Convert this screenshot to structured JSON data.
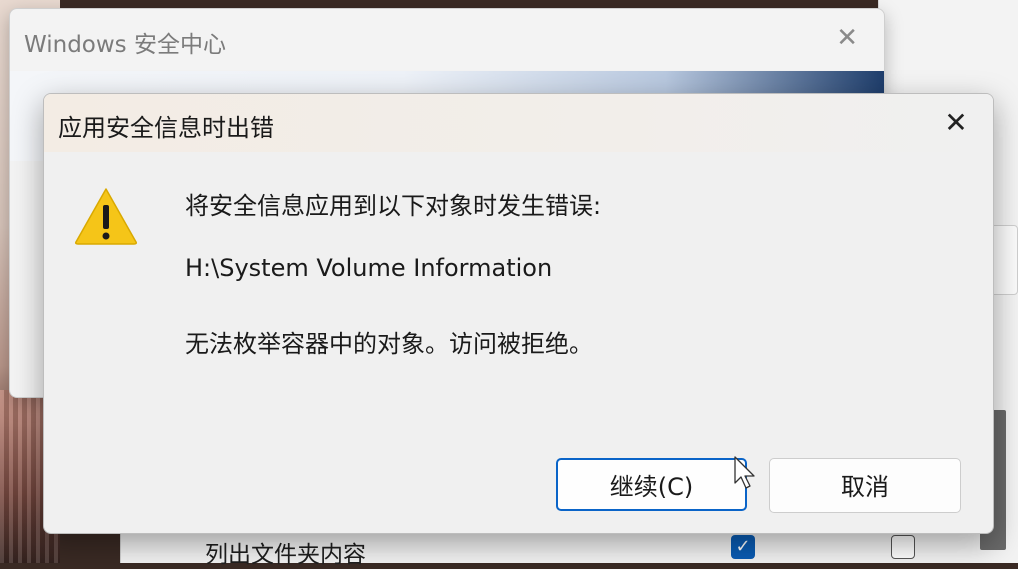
{
  "back_window": {
    "title": "Windows 安全中心",
    "close_glyph": "✕"
  },
  "dialog": {
    "title": "应用安全信息时出错",
    "close_glyph": "✕",
    "message_line1": "将安全信息应用到以下对象时发生错误:",
    "message_path": "H:\\System Volume Information",
    "message_line3": "无法枚举容器中的对象。访问被拒绝。",
    "icon": "warning-icon",
    "buttons": {
      "continue_label": "继续(C)",
      "cancel_label": "取消"
    }
  },
  "underlying_window": {
    "row_label": "列出文件夹内容",
    "allow_checked": true,
    "deny_checked": false
  },
  "colors": {
    "accent": "#0a64c8",
    "warning_yellow": "#f5c518"
  }
}
